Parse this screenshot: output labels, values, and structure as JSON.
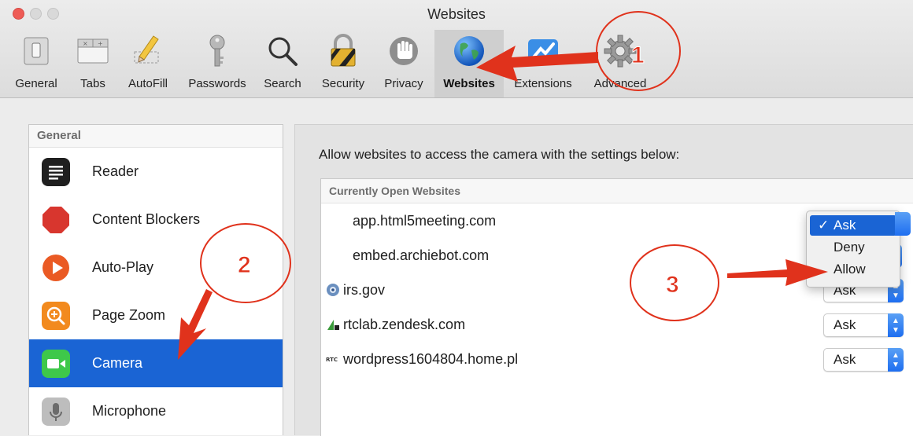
{
  "window": {
    "title": "Websites"
  },
  "toolbar": {
    "tabs": [
      {
        "label": "General",
        "icon": "general-switch-icon"
      },
      {
        "label": "Tabs",
        "icon": "tabs-icon"
      },
      {
        "label": "AutoFill",
        "icon": "pencil-icon"
      },
      {
        "label": "Passwords",
        "icon": "key-icon"
      },
      {
        "label": "Search",
        "icon": "magnifier-icon"
      },
      {
        "label": "Security",
        "icon": "lock-icon"
      },
      {
        "label": "Privacy",
        "icon": "hand-icon"
      },
      {
        "label": "Websites",
        "icon": "globe-icon",
        "active": true
      },
      {
        "label": "Extensions",
        "icon": "puzzle-icon"
      },
      {
        "label": "Advanced",
        "icon": "gear-icon"
      }
    ]
  },
  "sidebar": {
    "header": "General",
    "items": [
      {
        "label": "Reader",
        "icon": "reader-icon"
      },
      {
        "label": "Content Blockers",
        "icon": "stop-sign-icon"
      },
      {
        "label": "Auto-Play",
        "icon": "play-icon"
      },
      {
        "label": "Page Zoom",
        "icon": "zoom-icon"
      },
      {
        "label": "Camera",
        "icon": "camera-icon",
        "selected": true
      },
      {
        "label": "Microphone",
        "icon": "microphone-icon"
      }
    ]
  },
  "main": {
    "description": "Allow websites to access the camera with the settings below:",
    "list_header": "Currently Open Websites",
    "sites": [
      {
        "name": "app.html5meeting.com",
        "value": "Ask"
      },
      {
        "name": "embed.archiebot.com",
        "value": "Ask"
      },
      {
        "name": "irs.gov",
        "value": "Ask"
      },
      {
        "name": "rtclab.zendesk.com",
        "value": "Ask"
      },
      {
        "name": "wordpress1604804.home.pl",
        "value": "Ask"
      }
    ],
    "popup": {
      "options": [
        "Ask",
        "Deny",
        "Allow"
      ],
      "selected": "Ask",
      "highlighted": "Ask",
      "check": "✓"
    }
  },
  "annotations": {
    "labels": [
      "1",
      "2",
      "3"
    ],
    "color": "#e0321c"
  },
  "colors": {
    "selection": "#1a64d4",
    "stepper": "#2a7af0"
  }
}
